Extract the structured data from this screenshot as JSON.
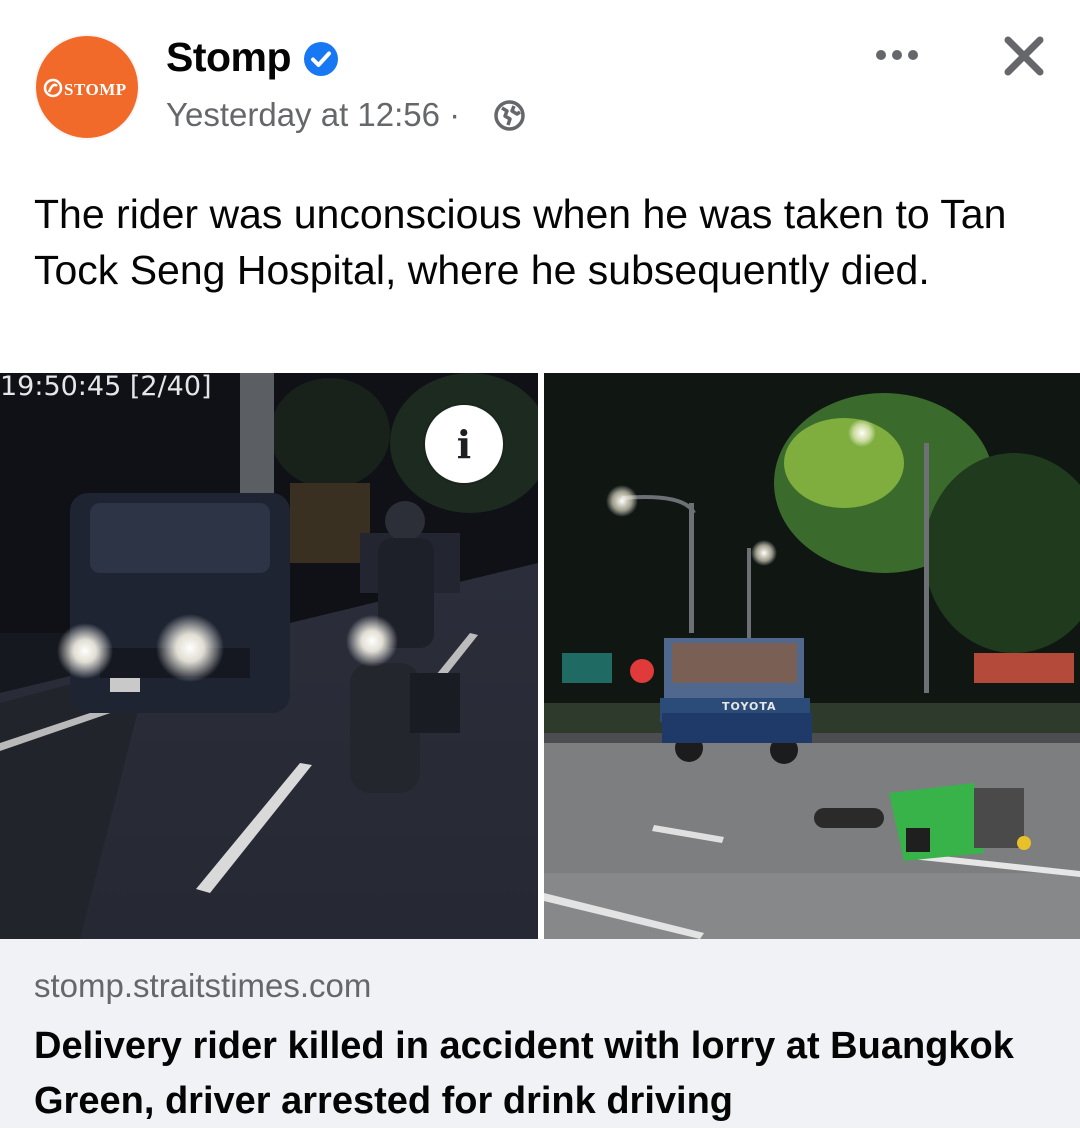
{
  "post": {
    "page_name": "Stomp",
    "avatar_text": "STOMP",
    "timestamp": "Yesterday at 12:56",
    "separator": "·",
    "privacy_icon": "globe-icon",
    "verified_icon": "verified-badge-icon",
    "more_icon": "more-options-icon",
    "close_icon": "close-icon",
    "text": "The rider was unconscious when he was taken to Tan Tock Seng Hospital, where he subsequently died."
  },
  "media": {
    "left_overlay_text": "19:50:45 [2/40]",
    "lorry_text": "TOYOTA",
    "info_icon": "info-icon",
    "info_label": "i"
  },
  "link_preview": {
    "domain": "stomp.straitstimes.com",
    "headline": "Delivery rider killed in accident with lorry at Buangkok Green, driver arrested for drink driving"
  },
  "colors": {
    "brand_orange": "#f26a2a",
    "verified_blue": "#1877f2",
    "secondary_text": "#65676b",
    "card_background": "#f0f2f5"
  }
}
